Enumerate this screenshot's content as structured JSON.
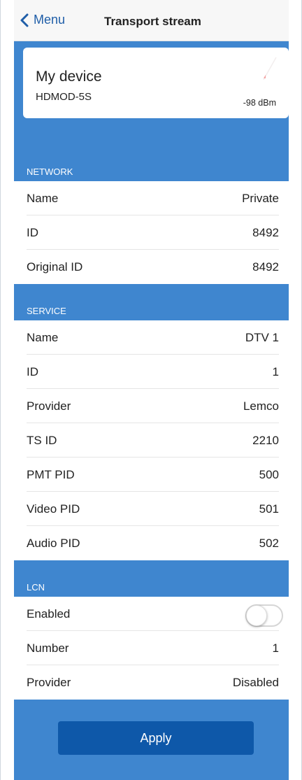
{
  "header": {
    "back_label": "Menu",
    "title": "Transport stream"
  },
  "device": {
    "name": "My device",
    "model": "HDMOD-5S",
    "signal": "-98 dBm",
    "signal_icon": "signal-strength-icon"
  },
  "network": {
    "title": "NETWORK",
    "rows": [
      {
        "label": "Name",
        "value": "Private"
      },
      {
        "label": "ID",
        "value": "8492"
      },
      {
        "label": "Original ID",
        "value": "8492"
      }
    ]
  },
  "service": {
    "title": "SERVICE",
    "rows": [
      {
        "label": "Name",
        "value": "DTV 1"
      },
      {
        "label": "ID",
        "value": "1"
      },
      {
        "label": "Provider",
        "value": "Lemco"
      },
      {
        "label": "TS ID",
        "value": "2210"
      },
      {
        "label": "PMT PID",
        "value": "500"
      },
      {
        "label": "Video PID",
        "value": "501"
      },
      {
        "label": "Audio PID",
        "value": "502"
      }
    ]
  },
  "lcn": {
    "title": "LCN",
    "enabled_label": "Enabled",
    "enabled": false,
    "rows": [
      {
        "label": "Number",
        "value": "1"
      },
      {
        "label": "Provider",
        "value": "Disabled"
      }
    ]
  },
  "footer": {
    "apply_label": "Apply"
  },
  "colors": {
    "accent": "#3f86cf",
    "button": "#0e58a9",
    "link": "#1f5ea8"
  }
}
